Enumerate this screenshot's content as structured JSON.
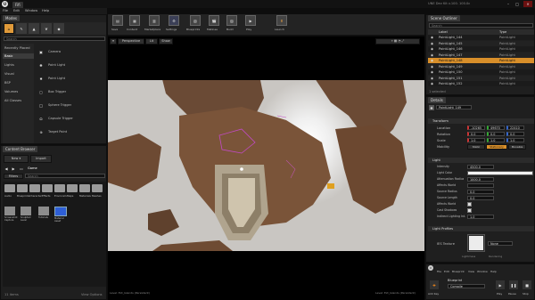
{
  "window": {
    "title": "UE4",
    "file_tab": "Fifi",
    "menu": [
      "File",
      "Edit",
      "Window",
      "Help"
    ],
    "right_title": "UNE Dev Kit v.100. 100.0c"
  },
  "modes": {
    "tab": "Modes",
    "search_placeholder": "Search",
    "categories": [
      "Recently Placed",
      "Basic",
      "Lights",
      "Visual",
      "BSP",
      "Volumes",
      "All Classes"
    ],
    "items": [
      "Camera",
      "Point Light",
      "Point Light",
      "Box Trigger",
      "Sphere Trigger",
      "Capsule Trigger",
      "Target Point"
    ]
  },
  "content_browser": {
    "tab": "Content Browser",
    "new_label": "New",
    "import_label": "Import",
    "path": "Game",
    "filter_label": "Filters",
    "search_placeholder": "Search",
    "folders": [
      "Audio",
      "Blueprints",
      "Characters",
      "Effects",
      "Environment",
      "Maps",
      "Materials",
      "Meshes"
    ],
    "assets": [
      "Screenshot Capture",
      "Sculpted Level",
      "Tutorials",
      "Material Asset"
    ],
    "status": "11 items",
    "view_options": "View Options"
  },
  "toolbar": {
    "buttons": [
      "Save",
      "Content",
      "Marketplace",
      "Settings",
      "Blueprints",
      "Matinee",
      "Build",
      "Play",
      "Launch"
    ]
  },
  "viewport": {
    "mode_button": "Perspective",
    "lit_button": "Lit",
    "show_button": "Show",
    "status_left": "Level: Ext_Islands (Persistent)",
    "status_right": "Level: Ext_Islands (Persistent)"
  },
  "scene_outliner": {
    "tab": "Scene Outliner",
    "search_placeholder": "Search",
    "col_label": "Label",
    "col_type": "Type",
    "rows": [
      {
        "label": "PointLight_144",
        "type": "PointLight"
      },
      {
        "label": "PointLight_145",
        "type": "PointLight"
      },
      {
        "label": "PointLight_146",
        "type": "PointLight"
      },
      {
        "label": "PointLight_147",
        "type": "PointLight"
      },
      {
        "label": "PointLight_148",
        "type": "PointLight"
      },
      {
        "label": "PointLight_149",
        "type": "PointLight"
      },
      {
        "label": "PointLight_150",
        "type": "PointLight"
      },
      {
        "label": "PointLight_151",
        "type": "PointLight"
      },
      {
        "label": "PointLight_152",
        "type": "PointLight"
      }
    ],
    "status": "1 selected"
  },
  "details": {
    "tab": "Details",
    "selected_name": "PointLight_149",
    "transform_header": "Transform",
    "location_label": "Location",
    "rotation_label": "Rotation",
    "scale_label": "Scale",
    "mobility_label": "Mobility",
    "location": [
      "-10265",
      "49670",
      "22410"
    ],
    "rotation": [
      "0.0",
      "0.0",
      "0.0"
    ],
    "scale": [
      "1.0",
      "1.0",
      "1.0"
    ],
    "mobility_opts": [
      "Static",
      "Stationary",
      "Movable"
    ],
    "light_header": "Light",
    "light_props": [
      {
        "label": "Intensity",
        "value": "4500.0"
      },
      {
        "label": "Light Color",
        "value": ""
      },
      {
        "label": "Attenuation Radius",
        "value": "1000.0"
      },
      {
        "label": "Affects World",
        "value": ""
      },
      {
        "label": "Source Radius",
        "value": "0.0"
      },
      {
        "label": "Source Length",
        "value": "0.0"
      },
      {
        "label": "Affects World",
        "value": "check"
      },
      {
        "label": "Cast Shadows",
        "value": "check"
      },
      {
        "label": "Indirect Lighting Int.",
        "value": "1.0"
      }
    ],
    "profile_header": "Light Profiles",
    "ies_label": "IES Texture",
    "ies_value": "None",
    "sections": [
      "Lightmass",
      "Rendering"
    ]
  },
  "blueprint_bar": {
    "menu": [
      "File",
      "Edit",
      "Blueprint",
      "View",
      "Window",
      "Help"
    ],
    "tab": "Blueprint",
    "dropdown_label": "Compile",
    "buttons": [
      "Add Key",
      "Play",
      "Pause",
      "Stop"
    ]
  },
  "colors": {
    "accent": "#e8821a",
    "selected_row": "#d88f2a",
    "panel": "#1f1f1f",
    "header": "#2b2b2b"
  }
}
